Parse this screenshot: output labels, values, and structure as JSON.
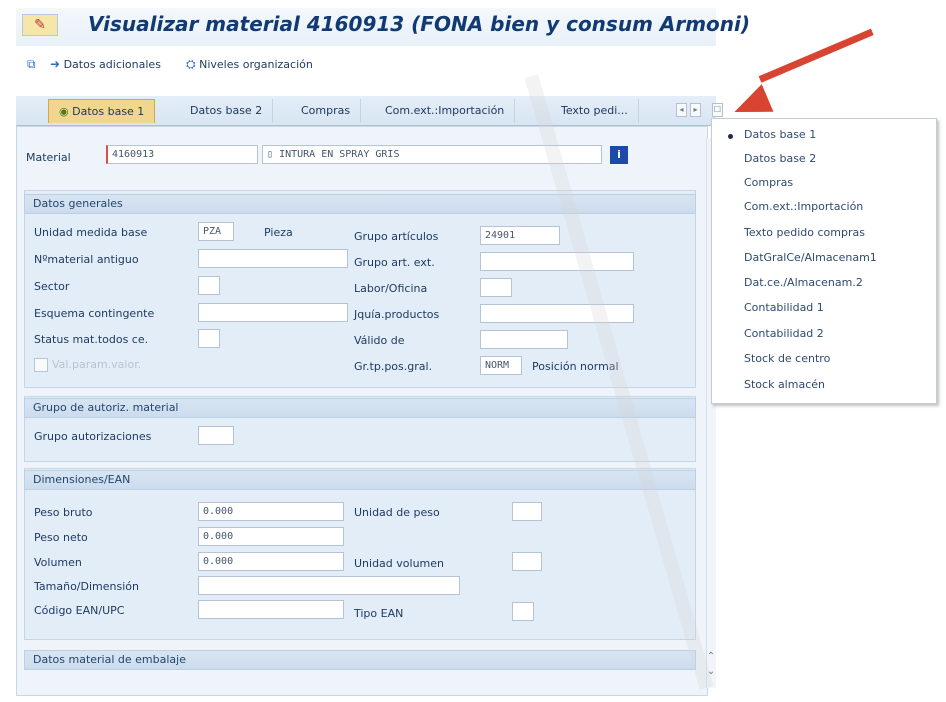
{
  "window": {
    "title": "Visualizar material 4160913 (FONA bien y consum Armoni)",
    "title_icon": "display-material-icon",
    "colors": {
      "title": "#123a72",
      "active_tab": "#f1d690",
      "required_marker": "#e14c4c",
      "arrow": "#d94432",
      "panel": "#eef4fa"
    }
  },
  "toolbar": {
    "additional_data": "Datos adicionales",
    "org_levels": "Niveles organización"
  },
  "tabs": [
    {
      "label": "Datos base 1",
      "active": true
    },
    {
      "label": "Datos base 2"
    },
    {
      "label": "Compras"
    },
    {
      "label": "Com.ext.:Importación"
    },
    {
      "label": "Texto pedi..."
    }
  ],
  "material": {
    "label": "Material",
    "number": "4160913",
    "description": "INTURA EN SPRAY GRIS",
    "info_icon": "i"
  },
  "datos_generales": {
    "heading": "Datos generales",
    "left": [
      {
        "label": "Unidad medida base",
        "value": "PZA",
        "text": "Pieza"
      },
      {
        "label": "Nºmaterial antiguo",
        "value": ""
      },
      {
        "label": "Sector",
        "value": ""
      },
      {
        "label": "Esquema contingente",
        "value": ""
      },
      {
        "label": "Status mat.todos ce.",
        "value": ""
      },
      {
        "label": "Val.param.valor.",
        "value": ""
      }
    ],
    "right": [
      {
        "label": "Grupo artículos",
        "value": "24901"
      },
      {
        "label": "Grupo art. ext.",
        "value": ""
      },
      {
        "label": "Labor/Oficina",
        "value": ""
      },
      {
        "label": "Jquía.productos",
        "value": ""
      },
      {
        "label": "Válido de",
        "value": ""
      },
      {
        "label": "Gr.tp.pos.gral.",
        "value": "NORM",
        "text": "Posición normal"
      }
    ]
  },
  "grupo_autoriz": {
    "heading": "Grupo de autoriz. material",
    "field_label": "Grupo autorizaciones",
    "value": ""
  },
  "dimensiones": {
    "heading": "Dimensiones/EAN",
    "rows": [
      {
        "label": "Peso bruto",
        "value": "0.000"
      },
      {
        "label": "Peso neto",
        "value": "0.000"
      },
      {
        "label": "Volumen",
        "value": "0.000"
      },
      {
        "label": "Tamaño/Dimensión",
        "value": ""
      },
      {
        "label": "Código EAN/UPC",
        "value": ""
      }
    ],
    "right": [
      {
        "label": "Unidad de peso",
        "value": ""
      },
      {
        "label": "Unidad volumen",
        "value": ""
      },
      {
        "label": "Tipo EAN",
        "value": ""
      }
    ]
  },
  "embalaje": {
    "heading": "Datos material de embalaje"
  },
  "tab_list": [
    {
      "label": "Datos base 1",
      "selected": true
    },
    {
      "label": "Datos base 2"
    },
    {
      "label": "Compras"
    },
    {
      "label": "Com.ext.:Importación"
    },
    {
      "label": "Texto pedido compras"
    },
    {
      "label": "DatGralCe/Almacenam1"
    },
    {
      "label": "Dat.ce./Almacenam.2"
    },
    {
      "label": "Contabilidad 1"
    },
    {
      "label": "Contabilidad 2"
    },
    {
      "label": "Stock de centro"
    },
    {
      "label": "Stock almacén"
    }
  ]
}
